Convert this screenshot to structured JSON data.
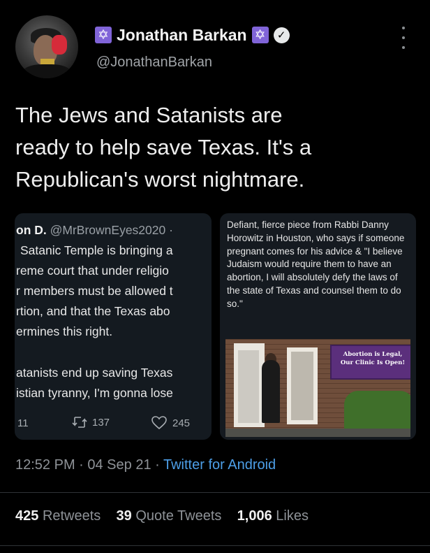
{
  "author": {
    "display_name": "Jonathan Barkan",
    "handle": "@JonathanBarkan",
    "badge_glyph": "✡",
    "badge_color": "#8064d8"
  },
  "tweet": {
    "line1": "The Jews and Satanists are",
    "line2": "ready to help save Texas. It's a",
    "line3": "Republican's worst nightmare."
  },
  "embedded_left": {
    "author": "on D.",
    "handle": "@MrBrownEyes2020 ·",
    "lines": [
      "Satanic Temple is bringing a",
      "reme court that under religio",
      "r members must be allowed t",
      "rtion, and that the Texas abo",
      "ermines this right.",
      "atanists end up saving Texas",
      "istian tyranny, I'm gonna lose"
    ],
    "reply_count": "11",
    "retweet_count": "137",
    "like_count": "245"
  },
  "embedded_right": {
    "text": "Defiant, fierce piece from Rabbi Danny Horowitz in Houston, who says if someone pregnant comes for his advice & \"I believe Judaism would require them to have an abortion, I will absolutely defy the laws of the state of Texas and counsel them to do so.\"",
    "banner_line1": "Abortion is Legal,",
    "banner_line2": "Our Clinic Is Open!"
  },
  "meta": {
    "time": "12:52 PM · 04 Sep 21 ·",
    "source": "Twitter for Android"
  },
  "stats": {
    "retweets_count": "425",
    "retweets_label": "Retweets",
    "quotes_count": "39",
    "quotes_label": "Quote Tweets",
    "likes_count": "1,006",
    "likes_label": "Likes"
  }
}
